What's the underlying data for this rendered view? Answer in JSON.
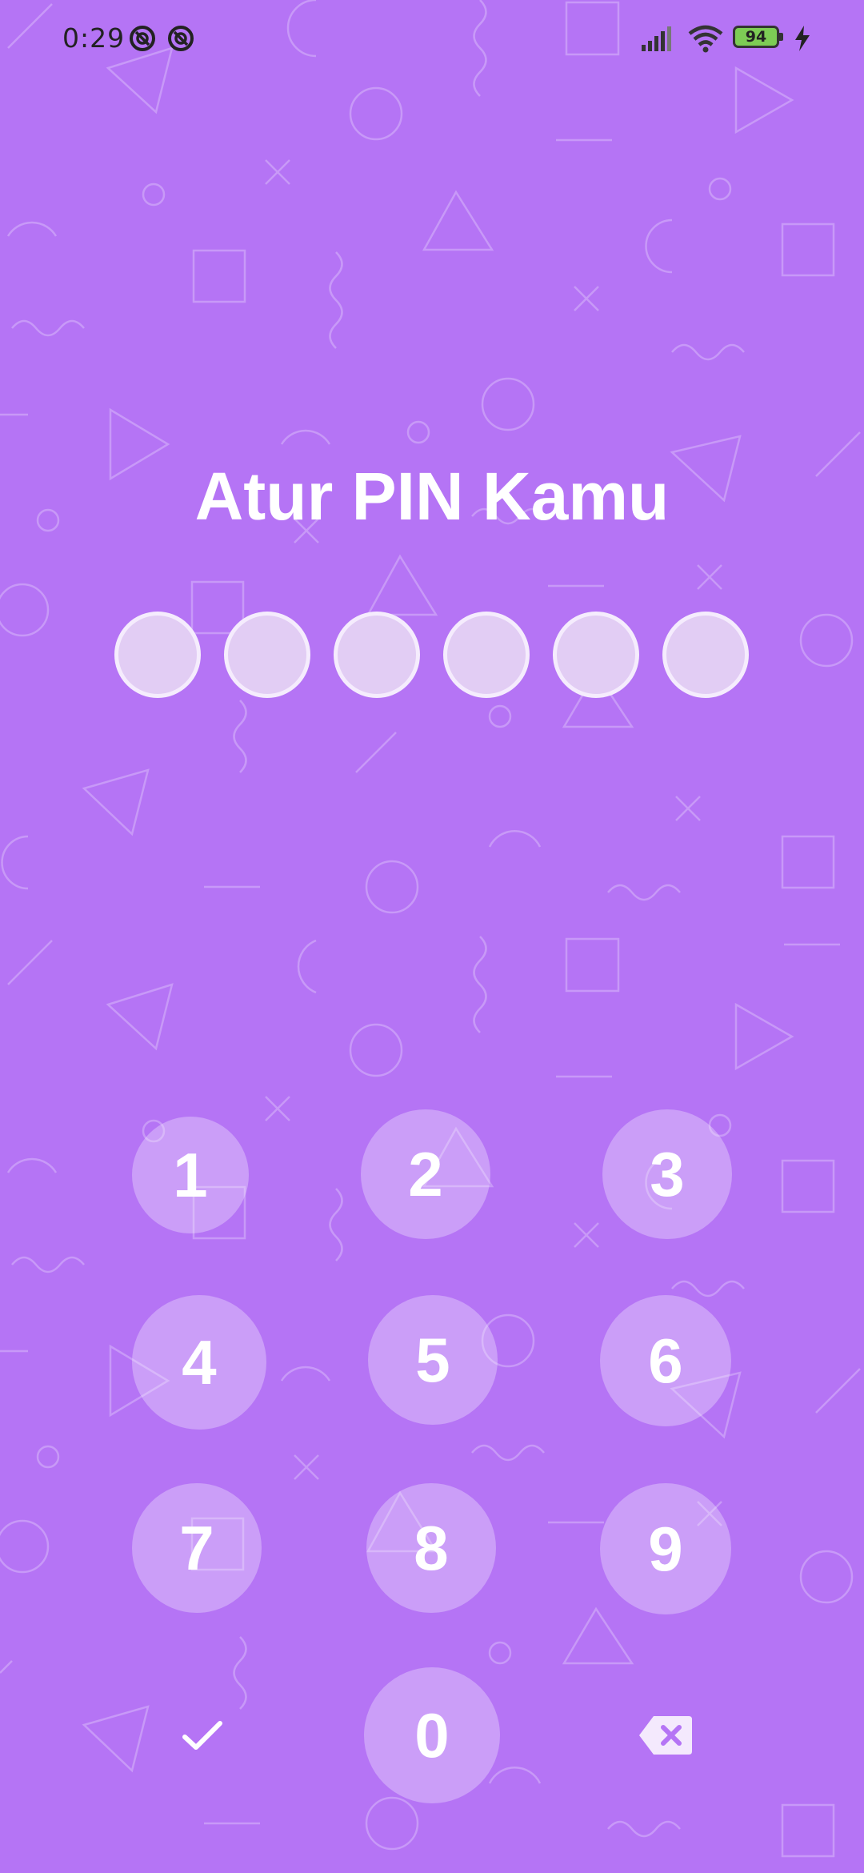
{
  "status_bar": {
    "time": "0:29",
    "battery_level": "94"
  },
  "title": "Atur PIN Kamu",
  "pin": {
    "length": 6,
    "filled": 0
  },
  "keypad": {
    "k1": "1",
    "k2": "2",
    "k3": "3",
    "k4": "4",
    "k5": "5",
    "k6": "6",
    "k7": "7",
    "k8": "8",
    "k9": "9",
    "k0": "0"
  },
  "icons": {
    "confirm": "check-icon",
    "delete": "backspace-icon",
    "notifications": [
      "app-notification-icon",
      "app-notification-icon"
    ],
    "signal": "signal-icon",
    "wifi": "wifi-icon",
    "battery": "battery-icon",
    "charging": "bolt-icon"
  },
  "colors": {
    "background": "#b574f5",
    "pin_dot": "#e2cdf4",
    "key": "rgba(255,255,255,0.30)",
    "text": "#ffffff"
  }
}
